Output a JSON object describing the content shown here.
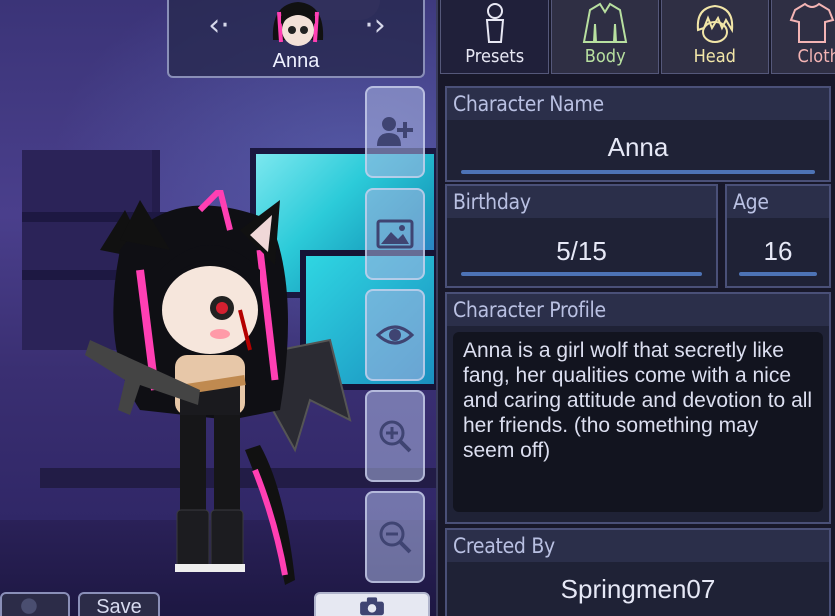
{
  "selector": {
    "character_name": "Anna",
    "prev_icon": "chevron-left-icon",
    "next_icon": "chevron-right-icon"
  },
  "tools": [
    {
      "icon": "add-user-icon"
    },
    {
      "icon": "image-icon"
    },
    {
      "icon": "eye-icon"
    },
    {
      "icon": "zoom-in-icon"
    },
    {
      "icon": "zoom-out-icon"
    }
  ],
  "bottom": {
    "save_label": "Save",
    "camera_icon": "camera-icon"
  },
  "tabs": [
    {
      "label": "Presets",
      "icon": "mannequin-icon",
      "color": "#e8e8f4"
    },
    {
      "label": "Body",
      "icon": "jacket-icon",
      "color": "#b8e0a0"
    },
    {
      "label": "Head",
      "icon": "hair-icon",
      "color": "#f2e6a8"
    },
    {
      "label": "Cloth",
      "icon": "shirt-icon",
      "color": "#f4b4b4"
    }
  ],
  "profile": {
    "name_caption": "Character Name",
    "name_value": "Anna",
    "birthday_caption": "Birthday",
    "birthday_value": "5/15",
    "age_caption": "Age",
    "age_value": "16",
    "profile_caption": "Character Profile",
    "profile_text": "Anna is a girl wolf that secretly like fang, her qualities come with a nice and caring attitude and devotion to all her friends. (tho something may seem off)",
    "created_caption": "Created By",
    "created_value": "Springmen07"
  },
  "colors": {
    "accent_underline": "#4d73b5",
    "panel_bg": "#18182a"
  }
}
